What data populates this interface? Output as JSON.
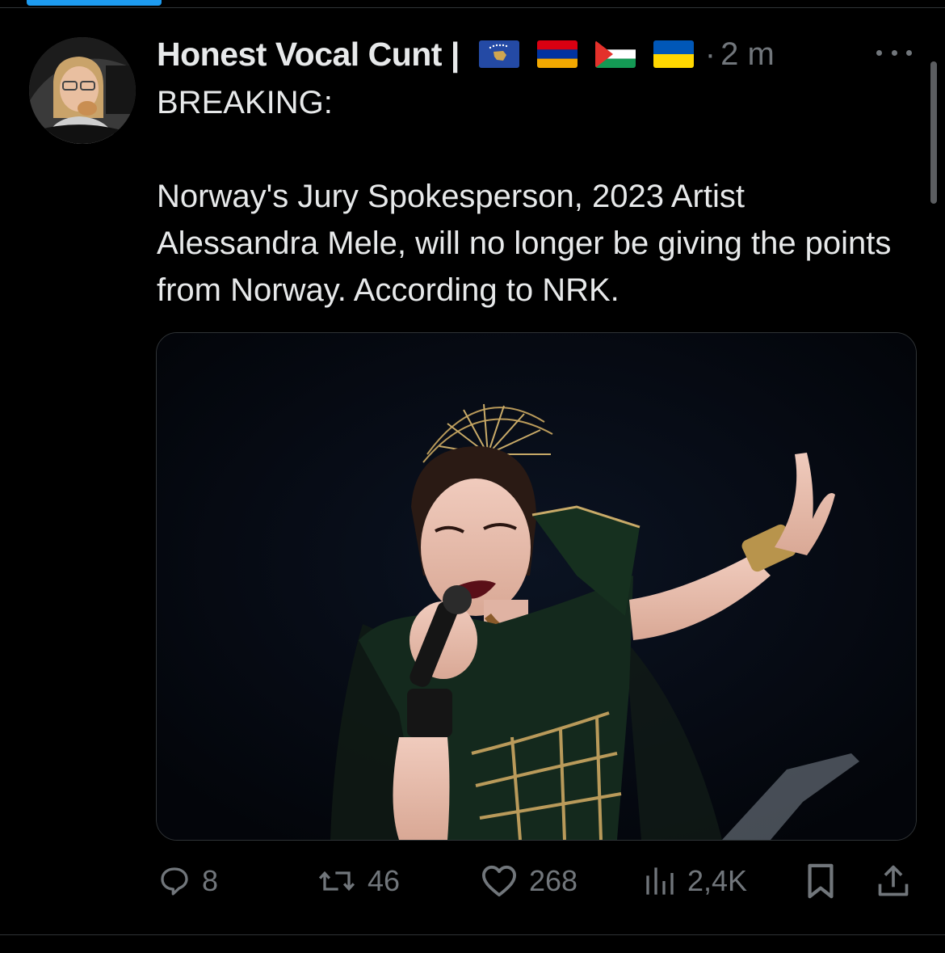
{
  "tweet": {
    "author": {
      "display_name": "Honest Vocal Cunt |",
      "flag_icons": [
        "kosovo-flag-icon",
        "armenia-flag-icon",
        "palestine-flag-icon",
        "ukraine-flag-icon"
      ]
    },
    "separator": "·",
    "time": "2 m",
    "text_line1": "BREAKING:",
    "text_body": "Norway's Jury Spokesperson, 2023 Artist Alessandra Mele, will no longer be giving the points from Norway. According to NRK.",
    "media": {
      "type": "photo"
    },
    "actions": {
      "replies": "8",
      "reposts": "46",
      "likes": "268",
      "views": "2,4K"
    }
  },
  "colors": {
    "background": "#000000",
    "text": "#e7e9ea",
    "secondary": "#71767b",
    "accent": "#1d9bf0",
    "divider": "#2f3336"
  },
  "icons": {
    "more": "more-horizontal-icon",
    "reply": "reply-bubble-icon",
    "repost": "repost-icon",
    "like": "heart-icon",
    "views": "views-bar-chart-icon",
    "bookmark": "bookmark-icon",
    "share": "share-icon"
  }
}
